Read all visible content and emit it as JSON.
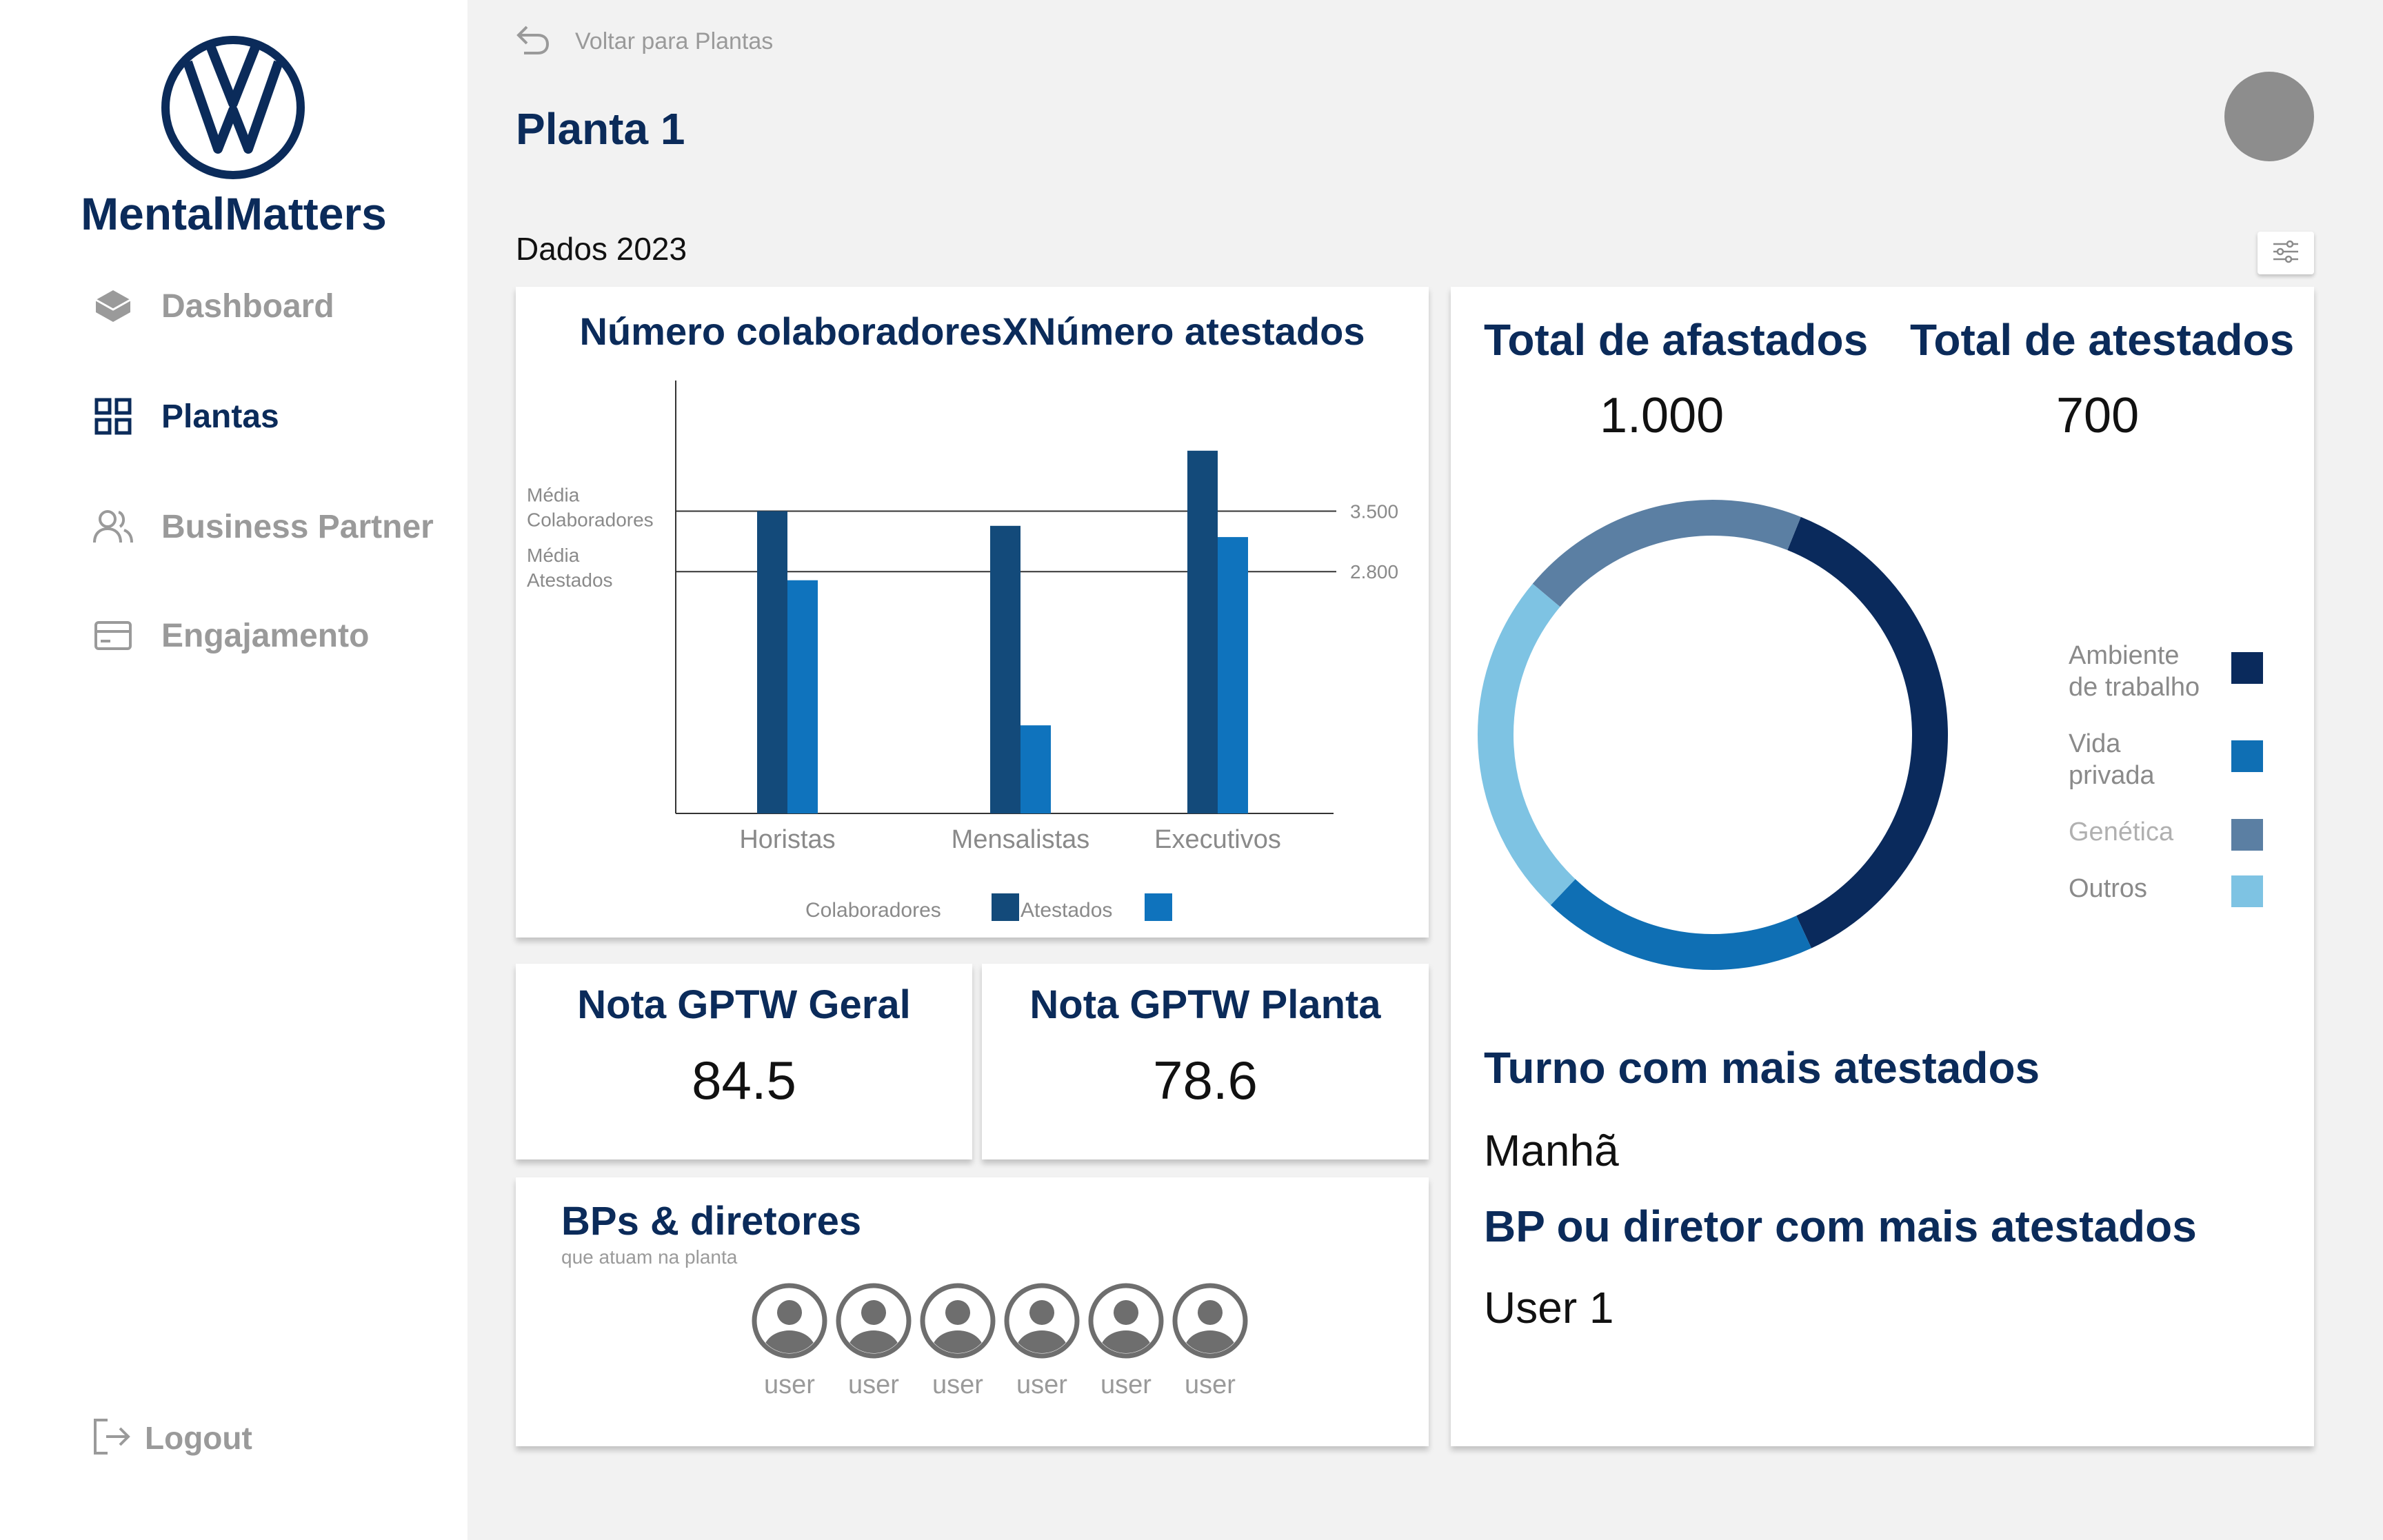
{
  "sidebar": {
    "brand": "MentalMatters",
    "items": [
      {
        "label": "Dashboard",
        "icon": "layers-icon",
        "active": false
      },
      {
        "label": "Plantas",
        "icon": "grid-icon",
        "active": true
      },
      {
        "label": "Business Partner",
        "icon": "users-icon",
        "active": false
      },
      {
        "label": "Engajamento",
        "icon": "card-icon",
        "active": false
      }
    ],
    "logout": "Logout"
  },
  "header": {
    "back_label": "Voltar para Plantas",
    "title": "Planta 1",
    "section": "Dados 2023"
  },
  "colors": {
    "primary": "#0b2b5a",
    "colaboradores": "#134a7a",
    "atestados": "#0f73bd",
    "ambiente": "#0a2a5c",
    "vida_privada": "#0f6fb4",
    "genetica": "#5b7fa3",
    "outros": "#7ec3e3"
  },
  "chart_data": {
    "type": "bar",
    "title": "Número colaboradoresXNúmero atestados",
    "categories": [
      "Horistas",
      "Mensalistas",
      "Executivos"
    ],
    "series": [
      {
        "name": "Colaboradores",
        "values": [
          3500,
          3330,
          4200
        ]
      },
      {
        "name": "Atestados",
        "values": [
          2700,
          1020,
          3200
        ]
      }
    ],
    "reference_lines": [
      {
        "label_line1": "Média",
        "label_line2": "Colaboradores",
        "value": 3500,
        "tick": "3.500"
      },
      {
        "label_line1": "Média",
        "label_line2": "Atestados",
        "value": 2800,
        "tick": "2.800"
      }
    ],
    "ylim": [
      0,
      5300
    ],
    "legend_position": "bottom"
  },
  "nota_geral": {
    "title": "Nota GPTW Geral",
    "value": "84.5"
  },
  "nota_planta": {
    "title": "Nota GPTW Planta",
    "value": "78.6"
  },
  "bps": {
    "title": "BPs & diretores",
    "subtitle": "que atuam na planta",
    "users": [
      "user",
      "user",
      "user",
      "user",
      "user",
      "user"
    ]
  },
  "totals": {
    "afastados_label": "Total de afastados",
    "afastados_value": "1.000",
    "atestados_label": "Total de atestados",
    "atestados_value": "700"
  },
  "donut_data": {
    "type": "pie",
    "segments": [
      {
        "name": "Ambiente de trabalho",
        "line1": "Ambiente",
        "line2": "de trabalho",
        "value": 37
      },
      {
        "name": "Vida privada",
        "line1": "Vida",
        "line2": "privada",
        "value": 19
      },
      {
        "name": "Genética",
        "line1": "Genética",
        "line2": "",
        "value": 20
      },
      {
        "name": "Outros",
        "line1": "Outros",
        "line2": "",
        "value": 24
      }
    ]
  },
  "turno": {
    "title": "Turno com mais atestados",
    "value": "Manhã"
  },
  "bp_diretor": {
    "title": "BP ou diretor com mais atestados",
    "value": "User 1"
  }
}
